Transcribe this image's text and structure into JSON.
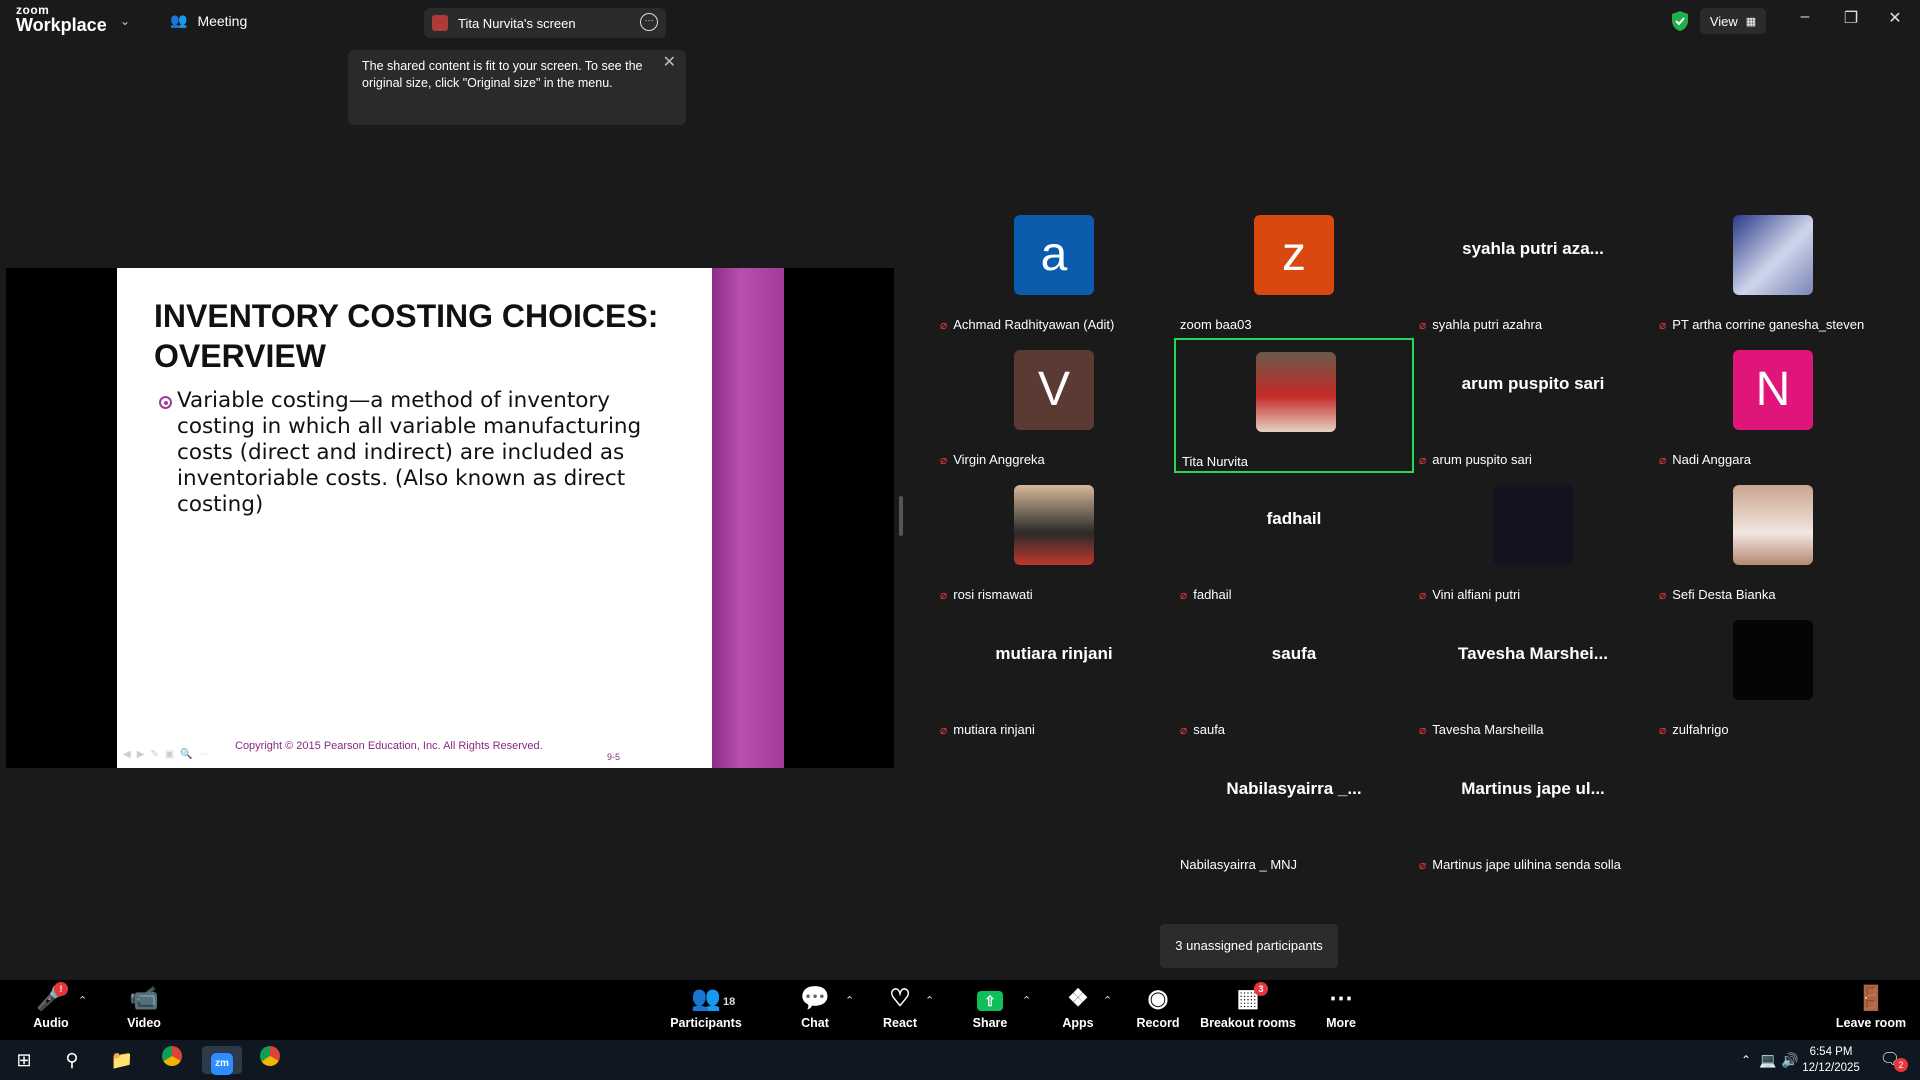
{
  "app": {
    "logo_top": "zoom",
    "logo_bottom": "Workplace"
  },
  "tabs": {
    "meeting": "Meeting",
    "screen": "Tita Nurvita's screen"
  },
  "view_label": "View",
  "tooltip": {
    "text": "The shared content is fit to your screen. To see the original size, click \"Original size\" in the menu."
  },
  "slide": {
    "title_line1": "INVENTORY COSTING CHOICES:",
    "title_line2": "OVERVIEW",
    "bullet_line1": "Variable costing—a method of inventory",
    "bullet_line2": "costing in which all variable manufacturing",
    "bullet_line3": "costs (direct and indirect) are included as",
    "bullet_line4": "inventoriable costs.  (Also known as direct",
    "bullet_line5": "costing)",
    "copyright": "Copyright © 2015 Pearson Education, Inc. All Rights Reserved.",
    "page": "9-5"
  },
  "participants": [
    {
      "name": "Achmad Radhityawan (Adit)",
      "initial": "a",
      "color": "#0b5cad",
      "muted": true
    },
    {
      "name": "zoom baa03",
      "initial": "z",
      "color": "#d9480f",
      "muted": false
    },
    {
      "name": "syahla putri azahra",
      "display": "syahla putri aza...",
      "muted": true
    },
    {
      "name": "PT artha corrine ganesha_steven",
      "muted": true
    },
    {
      "name": "Virgin Anggreka",
      "initial": "V",
      "color": "#5a3a32",
      "muted": true
    },
    {
      "name": "Tita Nurvita",
      "muted": false,
      "active": true
    },
    {
      "name": "arum puspito sari",
      "display": "arum puspito sari",
      "muted": true
    },
    {
      "name": "Nadi Anggara",
      "initial": "N",
      "color": "#e0157a",
      "muted": true
    },
    {
      "name": "rosi rismawati",
      "muted": true
    },
    {
      "name": "fadhail",
      "display": "fadhail",
      "muted": true
    },
    {
      "name": "Vini alfiani putri",
      "muted": true
    },
    {
      "name": "Sefi Desta Bianka",
      "muted": true
    },
    {
      "name": "mutiara rinjani",
      "display": "mutiara rinjani",
      "muted": true
    },
    {
      "name": "saufa",
      "display": "saufa",
      "muted": true
    },
    {
      "name": "Tavesha Marsheilla",
      "display": "Tavesha Marshei...",
      "muted": true
    },
    {
      "name": "zulfahrigo",
      "muted": true
    },
    {
      "name": "Nabilasyairra _ MNJ",
      "display": "Nabilasyairra _...",
      "muted": false
    },
    {
      "name": "Martinus jape ulihina senda solla",
      "display": "Martinus jape ul...",
      "muted": true
    }
  ],
  "unassigned": "3 unassigned participants",
  "toolbar": {
    "audio": "Audio",
    "video": "Video",
    "participants": "Participants",
    "participants_count": "18",
    "chat": "Chat",
    "react": "React",
    "share": "Share",
    "apps": "Apps",
    "record": "Record",
    "breakout": "Breakout rooms",
    "breakout_badge": "3",
    "more": "More",
    "leave": "Leave room",
    "audio_badge": "!"
  },
  "taskbar": {
    "time": "6:54 PM",
    "date": "12/12/2025",
    "notif": "2"
  },
  "colors": {
    "accent_green": "#23d959",
    "muted_red": "#e6363b",
    "share_green": "#0ebf5a"
  }
}
